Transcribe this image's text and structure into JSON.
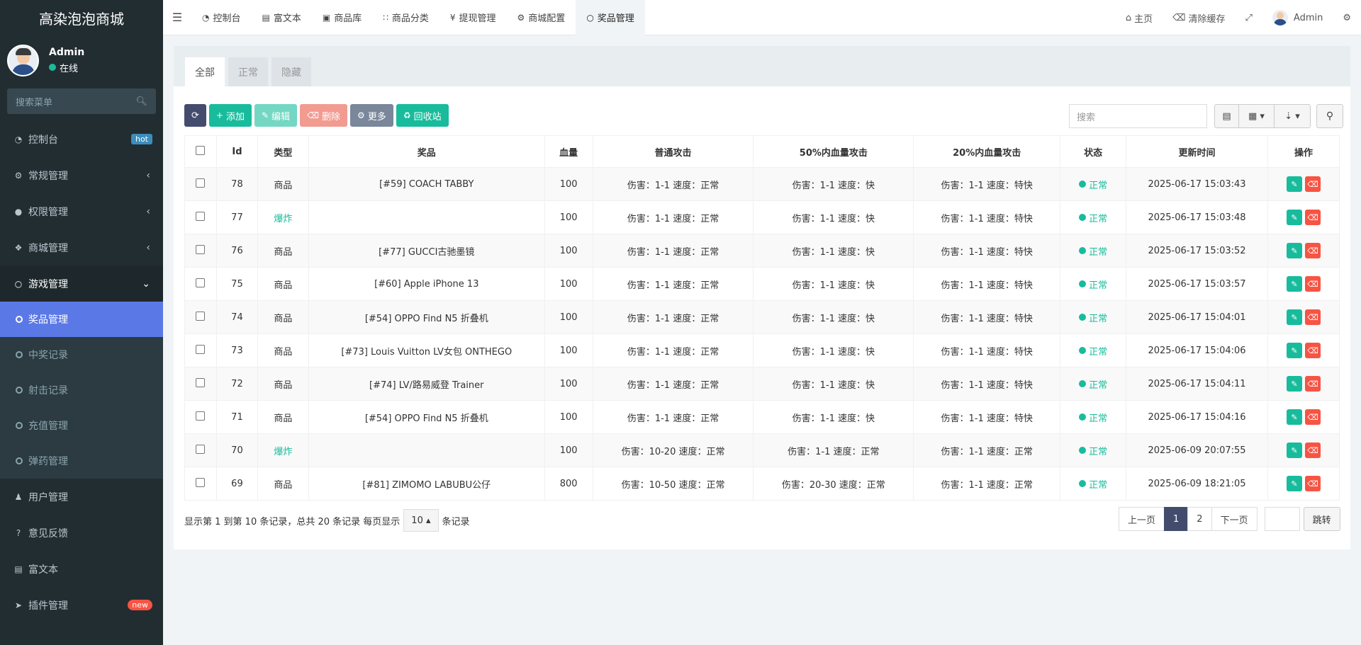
{
  "app": {
    "title": "高染泡泡商城"
  },
  "user": {
    "name": "Admin",
    "status": "在线"
  },
  "side_search": {
    "placeholder": "搜索菜单"
  },
  "sidebar": {
    "items": [
      {
        "label": "控制台",
        "badge": "hot",
        "icon": "dashboard-icon"
      },
      {
        "label": "常规管理",
        "icon": "cogs-icon"
      },
      {
        "label": "权限管理",
        "icon": "group-icon"
      },
      {
        "label": "商城管理",
        "icon": "dropbox-icon"
      },
      {
        "label": "游戏管理",
        "icon": "circle-icon"
      },
      {
        "label": "用户管理",
        "icon": "user-icon"
      },
      {
        "label": "意见反馈",
        "icon": "question-icon"
      },
      {
        "label": "富文本",
        "icon": "file-icon"
      },
      {
        "label": "插件管理",
        "badge": "new",
        "icon": "rocket-icon"
      }
    ],
    "sub_items": [
      "奖品管理",
      "中奖记录",
      "射击记录",
      "充值管理",
      "弹药管理"
    ]
  },
  "header": {
    "tabs": [
      "控制台",
      "富文本",
      "商品库",
      "商品分类",
      "提现管理",
      "商城配置",
      "奖品管理"
    ],
    "home": "主页",
    "clear_cache": "清除缓存",
    "admin": "Admin"
  },
  "panel_tabs": [
    "全部",
    "正常",
    "隐藏"
  ],
  "toolbar": {
    "add": "添加",
    "edit": "编辑",
    "delete": "删除",
    "more": "更多",
    "recycle": "回收站"
  },
  "search": {
    "placeholder": "搜索"
  },
  "table": {
    "headers": [
      "Id",
      "类型",
      "奖品",
      "血量",
      "普通攻击",
      "50%内血量攻击",
      "20%内血量攻击",
      "状态",
      "更新时间",
      "操作"
    ],
    "rows": [
      {
        "id": "78",
        "type": "商品",
        "prize": "[#59] COACH TABBY",
        "hp": "100",
        "normal": "伤害：1-1 速度：正常",
        "half": "伤害：1-1 速度：快",
        "fifth": "伤害：1-1 速度：特快",
        "status": "正常",
        "time": "2025-06-17 15:03:43"
      },
      {
        "id": "77",
        "type": "爆炸",
        "prize": "",
        "hp": "100",
        "normal": "伤害：1-1 速度：正常",
        "half": "伤害：1-1 速度：快",
        "fifth": "伤害：1-1 速度：特快",
        "status": "正常",
        "time": "2025-06-17 15:03:48"
      },
      {
        "id": "76",
        "type": "商品",
        "prize": "[#77] GUCCI古驰墨镜",
        "hp": "100",
        "normal": "伤害：1-1 速度：正常",
        "half": "伤害：1-1 速度：快",
        "fifth": "伤害：1-1 速度：特快",
        "status": "正常",
        "time": "2025-06-17 15:03:52"
      },
      {
        "id": "75",
        "type": "商品",
        "prize": "[#60] Apple iPhone 13",
        "hp": "100",
        "normal": "伤害：1-1 速度：正常",
        "half": "伤害：1-1 速度：快",
        "fifth": "伤害：1-1 速度：特快",
        "status": "正常",
        "time": "2025-06-17 15:03:57"
      },
      {
        "id": "74",
        "type": "商品",
        "prize": "[#54] OPPO Find N5 折叠机",
        "hp": "100",
        "normal": "伤害：1-1 速度：正常",
        "half": "伤害：1-1 速度：快",
        "fifth": "伤害：1-1 速度：特快",
        "status": "正常",
        "time": "2025-06-17 15:04:01"
      },
      {
        "id": "73",
        "type": "商品",
        "prize": "[#73] Louis Vuitton LV女包 ONTHEGO",
        "hp": "100",
        "normal": "伤害：1-1 速度：正常",
        "half": "伤害：1-1 速度：快",
        "fifth": "伤害：1-1 速度：特快",
        "status": "正常",
        "time": "2025-06-17 15:04:06"
      },
      {
        "id": "72",
        "type": "商品",
        "prize": "[#74] LV/路易威登 Trainer",
        "hp": "100",
        "normal": "伤害：1-1 速度：正常",
        "half": "伤害：1-1 速度：快",
        "fifth": "伤害：1-1 速度：特快",
        "status": "正常",
        "time": "2025-06-17 15:04:11"
      },
      {
        "id": "71",
        "type": "商品",
        "prize": "[#54] OPPO Find N5 折叠机",
        "hp": "100",
        "normal": "伤害：1-1 速度：正常",
        "half": "伤害：1-1 速度：快",
        "fifth": "伤害：1-1 速度：特快",
        "status": "正常",
        "time": "2025-06-17 15:04:16"
      },
      {
        "id": "70",
        "type": "爆炸",
        "prize": "",
        "hp": "100",
        "normal": "伤害：10-20 速度：正常",
        "half": "伤害：1-1 速度：正常",
        "fifth": "伤害：1-1 速度：正常",
        "status": "正常",
        "time": "2025-06-09 20:07:55"
      },
      {
        "id": "69",
        "type": "商品",
        "prize": "[#81] ZIMOMO LABUBU公仔",
        "hp": "800",
        "normal": "伤害：10-50 速度：正常",
        "half": "伤害：20-30 速度：正常",
        "fifth": "伤害：1-1 速度：正常",
        "status": "正常",
        "time": "2025-06-09 18:21:05"
      }
    ]
  },
  "footer": {
    "info_pre": "显示第 1 到第 10 条记录，总共 20 条记录 每页显示",
    "page_size": "10",
    "info_post": "条记录"
  },
  "pager": {
    "prev": "上一页",
    "p1": "1",
    "p2": "2",
    "next": "下一页",
    "jump": "跳转"
  },
  "colors": {
    "sidebar_bg": "#222d32",
    "active_sub": "#5b79e6",
    "green": "#18bc9c",
    "red": "#f75444",
    "dark_btn": "#444c6e"
  }
}
